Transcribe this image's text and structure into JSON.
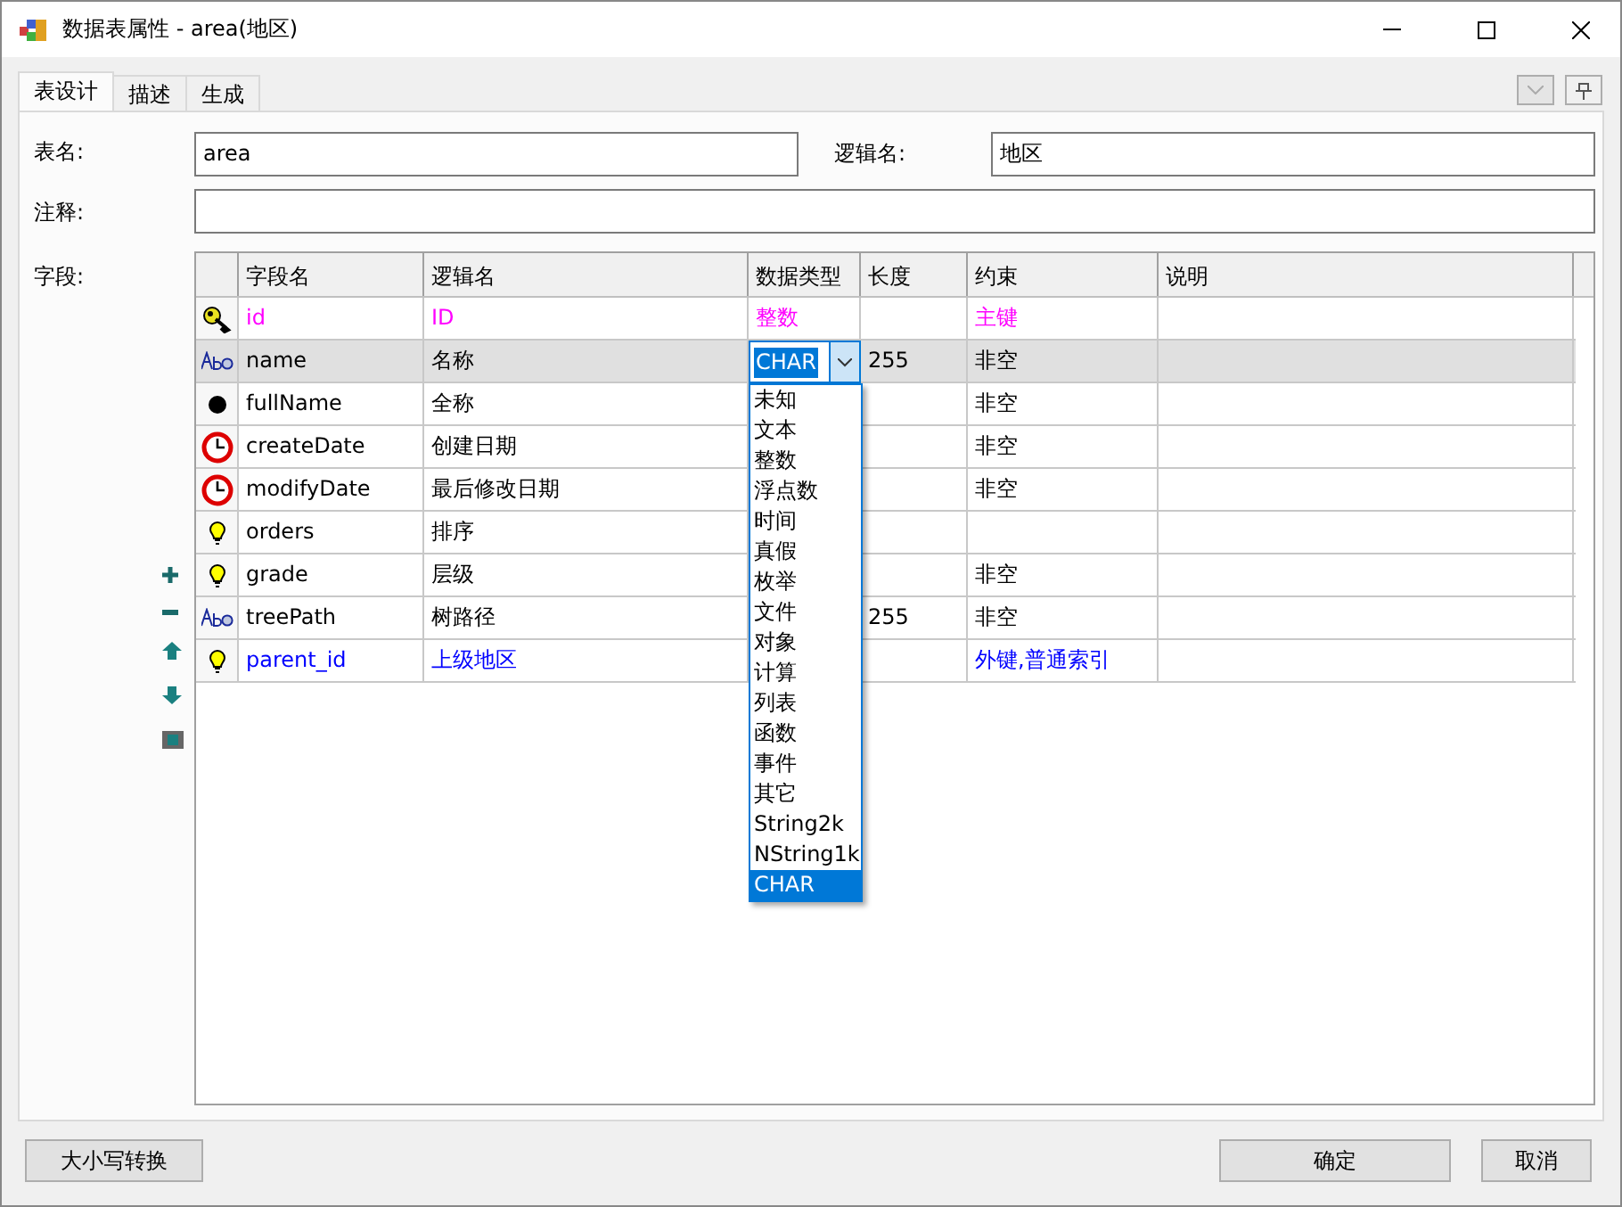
{
  "window": {
    "title": "数据表属性 - area(地区)"
  },
  "tabs": [
    {
      "label": "表设计",
      "selected": true
    },
    {
      "label": "描述",
      "selected": false
    },
    {
      "label": "生成",
      "selected": false
    }
  ],
  "form": {
    "table_name": {
      "label": "表名:",
      "value": "area"
    },
    "logical_name": {
      "label": "逻辑名:",
      "value": "地区"
    },
    "comment": {
      "label": "注释:"
    },
    "fields_label": "字段:"
  },
  "grid": {
    "columns": [
      "字段名",
      "逻辑名",
      "数据类型",
      "长度",
      "约束",
      "说明"
    ],
    "rows": [
      {
        "kind": "key",
        "color": "#ff00ff",
        "selected": false,
        "field_name": "id",
        "logical_name": "ID",
        "data_type": "整数",
        "constraint": "主键"
      },
      {
        "kind": "text",
        "color": "#000000",
        "selected": true,
        "field_name": "name",
        "logical_name": "名称",
        "data_type": "CHAR",
        "length": "255",
        "constraint": "非空"
      },
      {
        "kind": "dot",
        "color": "#000000",
        "selected": false,
        "field_name": "fullName",
        "logical_name": "全称",
        "constraint": "非空"
      },
      {
        "kind": "clock",
        "color": "#000000",
        "selected": false,
        "field_name": "createDate",
        "logical_name": "创建日期",
        "constraint": "非空"
      },
      {
        "kind": "clock",
        "color": "#000000",
        "selected": false,
        "field_name": "modifyDate",
        "logical_name": "最后修改日期",
        "constraint": "非空"
      },
      {
        "kind": "bulb",
        "color": "#000000",
        "selected": false,
        "field_name": "orders",
        "logical_name": "排序"
      },
      {
        "kind": "bulb",
        "color": "#000000",
        "selected": false,
        "field_name": "grade",
        "logical_name": "层级",
        "constraint": "非空"
      },
      {
        "kind": "text",
        "color": "#000000",
        "selected": false,
        "field_name": "treePath",
        "logical_name": "树路径",
        "length": "255",
        "constraint": "非空"
      },
      {
        "kind": "bulb",
        "color": "#0000ff",
        "selected": false,
        "field_name": "parent_id",
        "logical_name": "上级地区",
        "constraint": "外键,普通索引"
      }
    ]
  },
  "type_dropdown": {
    "options": [
      {
        "label": "未知",
        "selected": false
      },
      {
        "label": "文本",
        "selected": false
      },
      {
        "label": "整数",
        "selected": false
      },
      {
        "label": "浮点数",
        "selected": false
      },
      {
        "label": "时间",
        "selected": false
      },
      {
        "label": "真假",
        "selected": false
      },
      {
        "label": "枚举",
        "selected": false
      },
      {
        "label": "文件",
        "selected": false
      },
      {
        "label": "对象",
        "selected": false
      },
      {
        "label": "计算",
        "selected": false
      },
      {
        "label": "列表",
        "selected": false
      },
      {
        "label": "函数",
        "selected": false
      },
      {
        "label": "事件",
        "selected": false
      },
      {
        "label": "其它",
        "selected": false
      },
      {
        "label": "String2k",
        "selected": false
      },
      {
        "label": "NString1k",
        "selected": false
      },
      {
        "label": "CHAR",
        "selected": true
      }
    ]
  },
  "buttons": {
    "convert": "大小写转换",
    "ok": "确定",
    "cancel": "取消"
  }
}
